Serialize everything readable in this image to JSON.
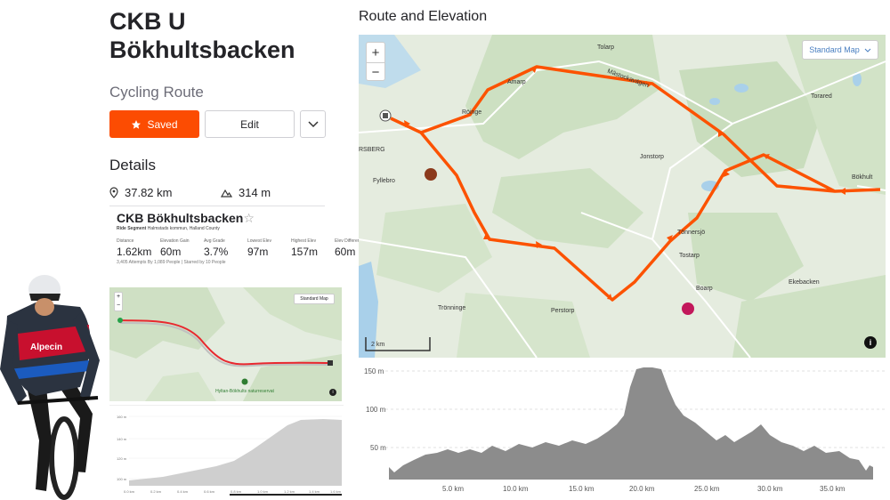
{
  "route": {
    "title": "CKB U Bökhultsbacken",
    "type": "Cycling Route",
    "saved_label": "Saved",
    "edit_label": "Edit",
    "details_heading": "Details",
    "distance": "37.82 km",
    "elevation": "314 m"
  },
  "segment": {
    "title": "CKB Bökhultsbacken",
    "star": "☆",
    "subtitle_bold": "Ride Segment",
    "subtitle_rest": " Halmstads kommun, Halland County",
    "stats": [
      {
        "label": "Distance",
        "value": "1.62km"
      },
      {
        "label": "Elevation Gain",
        "value": "60m"
      },
      {
        "label": "Avg Grade",
        "value": "3.7%"
      },
      {
        "label": "Lowest Elev",
        "value": "97m"
      },
      {
        "label": "Highest Elev",
        "value": "157m"
      },
      {
        "label": "Elev Difference",
        "value": "60m"
      }
    ],
    "footer": "3,405 Attempts By 1,089 People | Starred by 10 People",
    "map_type": "Standard Map",
    "poi_label": "Hyltan-Bökhults naturreservat",
    "elev_ylabels": [
      "160 m",
      "140 m",
      "120 m",
      "100 m"
    ],
    "elev_xlabels": [
      "0.0 km",
      "0.2 km",
      "0.4 km",
      "0.6 km",
      "0.8 km",
      "1.0 km",
      "1.2 km",
      "1.4 km",
      "1.6 km"
    ]
  },
  "main": {
    "section_title": "Route and Elevation",
    "map_type": "Standard Map",
    "zoom_in": "+",
    "zoom_out": "−",
    "scale": "2 km",
    "places": [
      {
        "name": "Tolarp"
      },
      {
        "name": "Amarp"
      },
      {
        "name": "Mästockavägen"
      },
      {
        "name": "Röinge"
      },
      {
        "name": "Torared"
      },
      {
        "name": "RSBERG"
      },
      {
        "name": "Jonstorp"
      },
      {
        "name": "Bökhult"
      },
      {
        "name": "Fyllebro"
      },
      {
        "name": "Tönnersjö"
      },
      {
        "name": "Tostarp"
      },
      {
        "name": "Ekebacken"
      },
      {
        "name": "Boarp"
      },
      {
        "name": "Trönninge"
      },
      {
        "name": "Perstorp"
      }
    ],
    "elev_ylabels": [
      "150 m",
      "100 m",
      "50 m"
    ],
    "elev_xlabels": [
      "5.0 km",
      "10.0 km",
      "15.0 km",
      "20.0 km",
      "25.0 km",
      "30.0 km",
      "35.0 km"
    ]
  },
  "colors": {
    "accent": "#fc4c02",
    "route": "#fc5200",
    "elevation_fill": "#8c8c8c",
    "map_green": "#cfe0c4",
    "water": "#a9d0ea"
  }
}
